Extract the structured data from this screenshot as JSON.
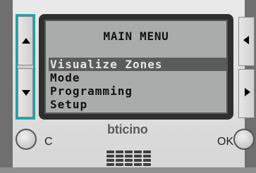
{
  "screen": {
    "title": "MAIN MENU",
    "items": [
      {
        "label": "Visualize Zones",
        "selected": true
      },
      {
        "label": "Mode",
        "selected": false
      },
      {
        "label": "Programming",
        "selected": false
      },
      {
        "label": "Setup",
        "selected": false
      }
    ]
  },
  "buttons": {
    "c_label": "C",
    "ok_label": "OK"
  },
  "brand": "bticino",
  "colors": {
    "nav_highlight": "#1aa6a8",
    "lcd_bg": "#a9acab",
    "selection_bg": "#5b5b5b"
  }
}
